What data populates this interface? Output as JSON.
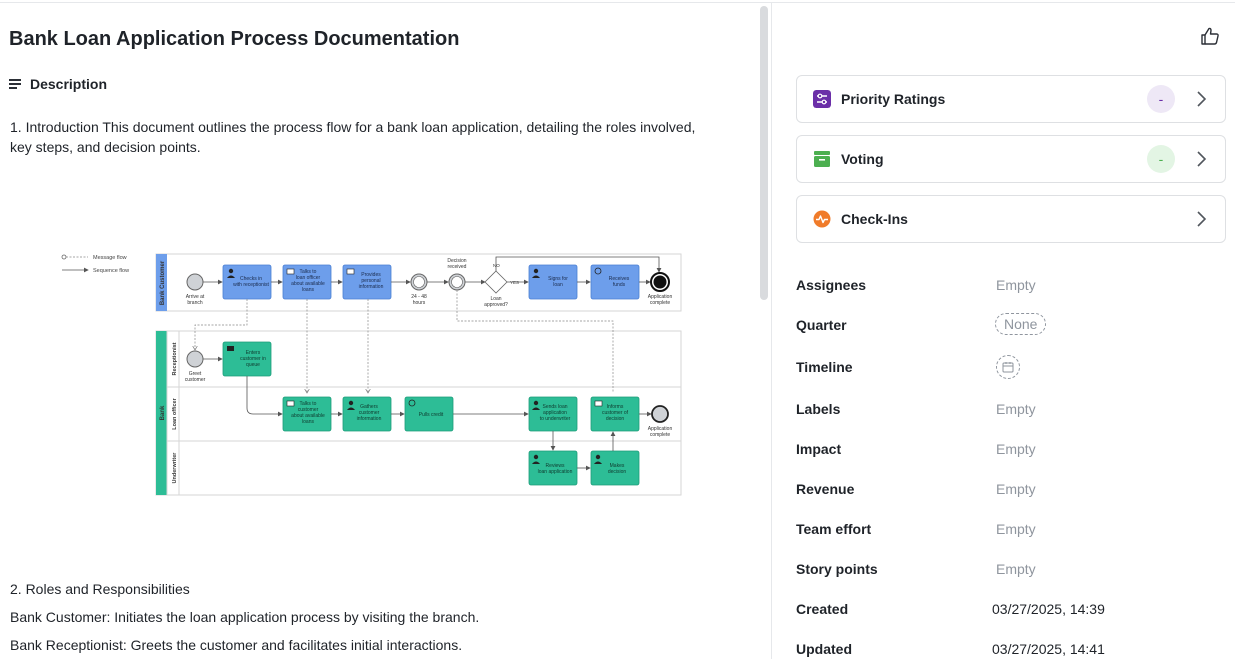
{
  "document": {
    "title": "Bank Loan Application Process Documentation",
    "description_heading": "Description",
    "intro_line1": "1. Introduction This document outlines the process flow for a bank loan application, detailing the roles involved,",
    "intro_line2": "key steps, and decision points.",
    "section2_heading": "2. Roles and Responsibilities",
    "role_customer": "Bank Customer: Initiates the loan application process by visiting the branch.",
    "role_receptionist": "Bank Receptionist: Greets the customer and facilitates initial interactions."
  },
  "diagram": {
    "legend_message": "Message flow",
    "legend_sequence": "Sequence flow",
    "pool_customer": "Bank Customer",
    "pool_bank": "Bank",
    "lane_receptionist": "Receptionist",
    "lane_loan_officer": "Loan officer",
    "lane_underwriter": "Underwriter",
    "arrive_l1": "Arrive at",
    "arrive_l2": "branch",
    "task_checkin_l1": "Checks in",
    "task_checkin_l2": "with receptionist",
    "task_talk_l1": "Talks to",
    "task_talk_l2": "loan officer",
    "task_talk_l3": "about available",
    "task_talk_l4": "loans",
    "task_provide_l1": "Provides",
    "task_provide_l2": "personal",
    "task_provide_l3": "information",
    "timer_l1": "24 - 48",
    "timer_l2": "hours",
    "decision_l1": "Decision",
    "decision_l2": "received",
    "no_label": "NO",
    "yes_label": "YES",
    "gateway_l1": "Loan",
    "gateway_l2": "approved?",
    "task_signs_l1": "Signs for",
    "task_signs_l2": "loan",
    "task_funds_l1": "Receives",
    "task_funds_l2": "funds",
    "end_cust_l1": "Application",
    "end_cust_l2": "complete",
    "greet_l1": "Greet",
    "greet_l2": "customer",
    "task_enter_l1": "Enters",
    "task_enter_l2": "customer in",
    "task_enter_l3": "queue",
    "task_bank_talk_l1": "Talks to",
    "task_bank_talk_l2": "customer",
    "task_bank_talk_l3": "about available",
    "task_bank_talk_l4": "loans",
    "task_gather_l1": "Gathers",
    "task_gather_l2": "customer",
    "task_gather_l3": "information",
    "task_credit": "Pulls credit",
    "task_sends_l1": "Sends loan",
    "task_sends_l2": "application",
    "task_sends_l3": "to underwriter",
    "task_informs_l1": "Informs",
    "task_informs_l2": "customer of",
    "task_informs_l3": "decision",
    "end_bank_l1": "Application",
    "end_bank_l2": "complete",
    "task_reviews_l1": "Reviews",
    "task_reviews_l2": "loan application",
    "task_makes_l1": "Makes",
    "task_makes_l2": "decision"
  },
  "sidebar": {
    "cards": [
      {
        "label": "Priority Ratings",
        "value": "-",
        "icon": "priority-ratings-icon",
        "color": "#6b2fa8"
      },
      {
        "label": "Voting",
        "value": "-",
        "icon": "voting-icon",
        "color": "#4caf50"
      },
      {
        "label": "Check-Ins",
        "icon": "check-ins-icon",
        "color": "#f07b2a"
      }
    ],
    "props": {
      "assignees_label": "Assignees",
      "assignees_value": "Empty",
      "quarter_label": "Quarter",
      "quarter_value": "None",
      "timeline_label": "Timeline",
      "labels_label": "Labels",
      "labels_value": "Empty",
      "impact_label": "Impact",
      "impact_value": "Empty",
      "revenue_label": "Revenue",
      "revenue_value": "Empty",
      "team_effort_label": "Team effort",
      "team_effort_value": "Empty",
      "story_points_label": "Story points",
      "story_points_value": "Empty",
      "created_label": "Created",
      "created_value": "03/27/2025, 14:39",
      "updated_label": "Updated",
      "updated_value": "03/27/2025, 14:41"
    }
  },
  "colors": {
    "blue_task": "#6d9eeb",
    "green_task": "#2dbd96",
    "pool_accent_blue": "#6d9eeb",
    "pool_accent_green": "#2dbd96"
  }
}
